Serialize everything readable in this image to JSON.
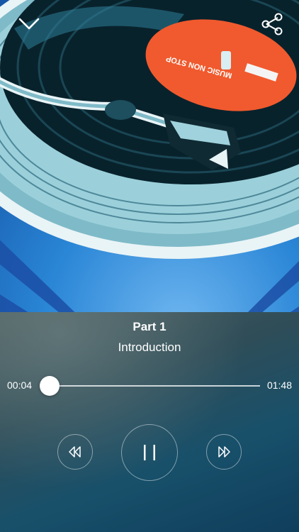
{
  "artwork": {
    "label_text": "MUSIC NON STOP",
    "colors": {
      "sky": "#2c84d4",
      "vinyl": "#0a2530",
      "label": "#f05a2e",
      "platter": "#8fc3cf"
    }
  },
  "header": {
    "collapse_icon": "chevron-down-icon",
    "share_icon": "share-icon"
  },
  "track": {
    "title": "Part 1",
    "chapter": "Introduction"
  },
  "playback": {
    "elapsed": "00:04",
    "duration": "01:48",
    "progress": 0.037,
    "state": "playing",
    "accent_color": "#1fb24a"
  },
  "controls": {
    "rewind_icon": "rewind-icon",
    "pause_icon": "pause-icon",
    "forward_icon": "fast-forward-icon"
  }
}
